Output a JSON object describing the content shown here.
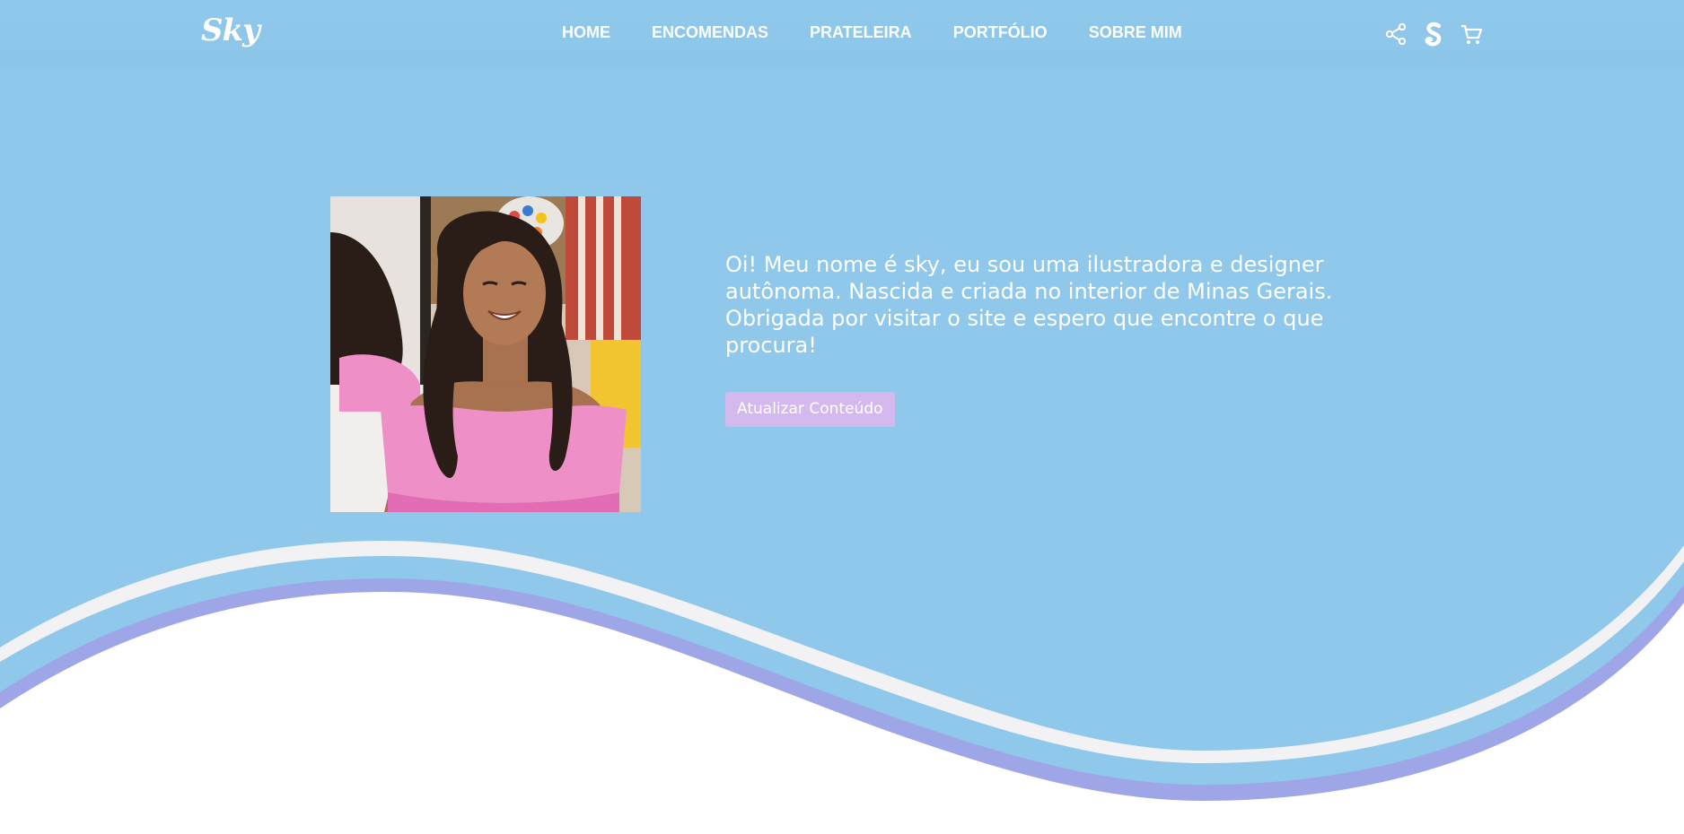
{
  "brand": {
    "logo_text": "Sky"
  },
  "nav": {
    "items": [
      {
        "label": "HOME"
      },
      {
        "label": "ENCOMENDAS"
      },
      {
        "label": "PRATELEIRA"
      },
      {
        "label": "PORTFÓLIO"
      },
      {
        "label": "SOBRE MIM"
      }
    ]
  },
  "header_icons": [
    "share-icon",
    "brand-s-icon",
    "cart-icon"
  ],
  "hero": {
    "photo_icon": "profile-photo",
    "intro_text": "Oi! Meu nome é sky, eu sou uma ilustradora e designer autônoma. Nascida e criada no interior de Minas Gerais. Obrigada por visitar o site e espero que encontre o que procura!",
    "button_label": "Atualizar Conteúdo"
  },
  "colors": {
    "background": "#8fc8ea",
    "button": "#d4b9ee",
    "wave_light": "#f2f2f4",
    "wave_purple": "#9ea6e8",
    "bottom": "#ffffff"
  }
}
